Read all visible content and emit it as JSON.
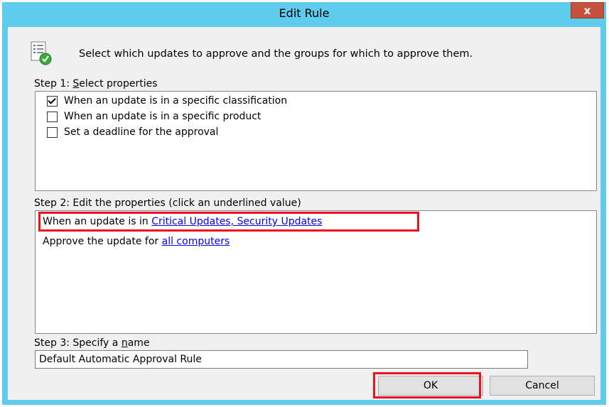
{
  "window": {
    "title": "Edit Rule",
    "close_glyph": "x"
  },
  "header": {
    "icon": "approval-rule-icon",
    "instruction": "Select which updates to approve and the groups for which to approve them."
  },
  "step1": {
    "label_before": "Step 1: ",
    "label_accel": "S",
    "label_after": "elect properties",
    "properties": [
      {
        "label": "When an update is in a specific classification",
        "checked": true
      },
      {
        "label": "When an update is in a specific product",
        "checked": false
      },
      {
        "label": "Set a deadline for the approval",
        "checked": false
      }
    ]
  },
  "step2": {
    "label": "Step 2: Edit the properties (click an underlined value)",
    "line1_text": "When an update is in ",
    "line1_link": "Critical Updates, Security Updates",
    "line2_text": "Approve the update for ",
    "line2_link": "all computers"
  },
  "step3": {
    "label_before": "Step 3: Specify a ",
    "label_accel": "n",
    "label_after": "ame",
    "name_value": "Default Automatic Approval Rule"
  },
  "buttons": {
    "ok_label": "OK",
    "cancel_label": "Cancel"
  },
  "colors": {
    "titlebar": "#5fcbed",
    "close_button": "#c7513f",
    "highlight": "#e8131d",
    "link": "#0000ee"
  }
}
